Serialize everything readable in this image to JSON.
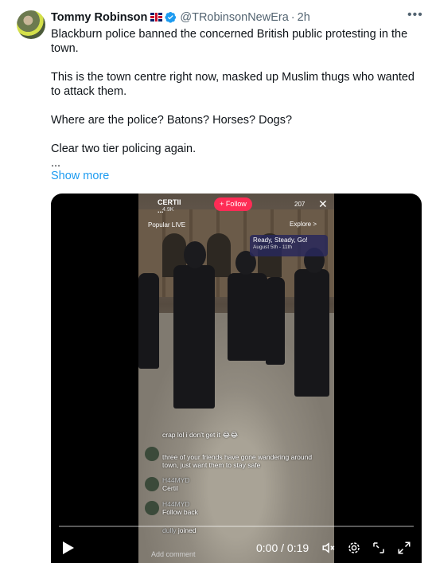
{
  "author": {
    "name": "Tommy Robinson",
    "handle": "@TRobinsonNewEra",
    "time": "2h"
  },
  "tweet": {
    "lines": [
      "Blackburn police banned the concerned British public protesting in the town.",
      "This is the town centre right now, masked up Muslim thugs who wanted to attack them.",
      "Where are the police? Batons? Horses? Dogs?",
      "Clear two tier policing again.",
      "..."
    ],
    "show_more": "Show more"
  },
  "video": {
    "live_name": "CERTII ...",
    "live_likes": "4.9K",
    "follow_label": "+ Follow",
    "viewer_count": "207",
    "popular_live": "Popular LIVE",
    "explore": "Explore >",
    "event_title": "Ready, Steady, Go!",
    "event_date": "August 5th - 11th",
    "comments": [
      {
        "user": "",
        "text": "crap lol i don't get it 😂😂"
      },
      {
        "user": "",
        "text": "three of your friends have gone wandering around town, just want them to stay safe"
      },
      {
        "user": "H44MYD",
        "text": "Certil"
      },
      {
        "user": "H44MYD",
        "text": "Follow back"
      },
      {
        "user": "dully",
        "text": "joined"
      }
    ],
    "add_comment": "Add comment",
    "timecode": "0:00 / 0:19",
    "progress": 0
  },
  "colors": {
    "accent": "#1d9bf0",
    "text": "#0f1419",
    "muted": "#536471",
    "verified": "#1d9bf0"
  },
  "icons": [
    "verified-badge-icon",
    "uk-flag-icon",
    "more-icon",
    "play-icon",
    "volume-muted-icon",
    "settings-gear-icon",
    "picture-in-picture-icon",
    "fullscreen-icon"
  ]
}
